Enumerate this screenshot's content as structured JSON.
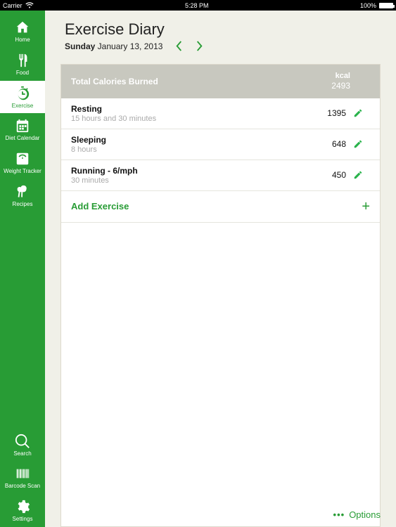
{
  "status": {
    "carrier": "Carrier",
    "time": "5:28 PM",
    "battery_pct": "100%"
  },
  "sidebar": {
    "top": [
      {
        "key": "home",
        "label": "Home"
      },
      {
        "key": "food",
        "label": "Food"
      },
      {
        "key": "exercise",
        "label": "Exercise"
      },
      {
        "key": "diet-calendar",
        "label": "Diet Calendar"
      },
      {
        "key": "weight-tracker",
        "label": "Weight Tracker"
      },
      {
        "key": "recipes",
        "label": "Recipes"
      }
    ],
    "bottom": [
      {
        "key": "search",
        "label": "Search"
      },
      {
        "key": "barcode-scan",
        "label": "Barcode Scan"
      },
      {
        "key": "settings",
        "label": "Settings"
      }
    ],
    "active": "exercise"
  },
  "header": {
    "title": "Exercise Diary",
    "weekday": "Sunday",
    "date_rest": " January 13, 2013"
  },
  "totals": {
    "label": "Total Calories Burned",
    "unit": "kcal",
    "value": "2493"
  },
  "entries": [
    {
      "title": "Resting",
      "subtitle": "15 hours and 30 minutes",
      "value": "1395"
    },
    {
      "title": "Sleeping",
      "subtitle": "8 hours",
      "value": "648"
    },
    {
      "title": "Running - 6/mph",
      "subtitle": "30 minutes",
      "value": "450"
    }
  ],
  "add_label": "Add Exercise",
  "footer": {
    "options_label": "Options"
  },
  "colors": {
    "brand": "#289c35"
  }
}
